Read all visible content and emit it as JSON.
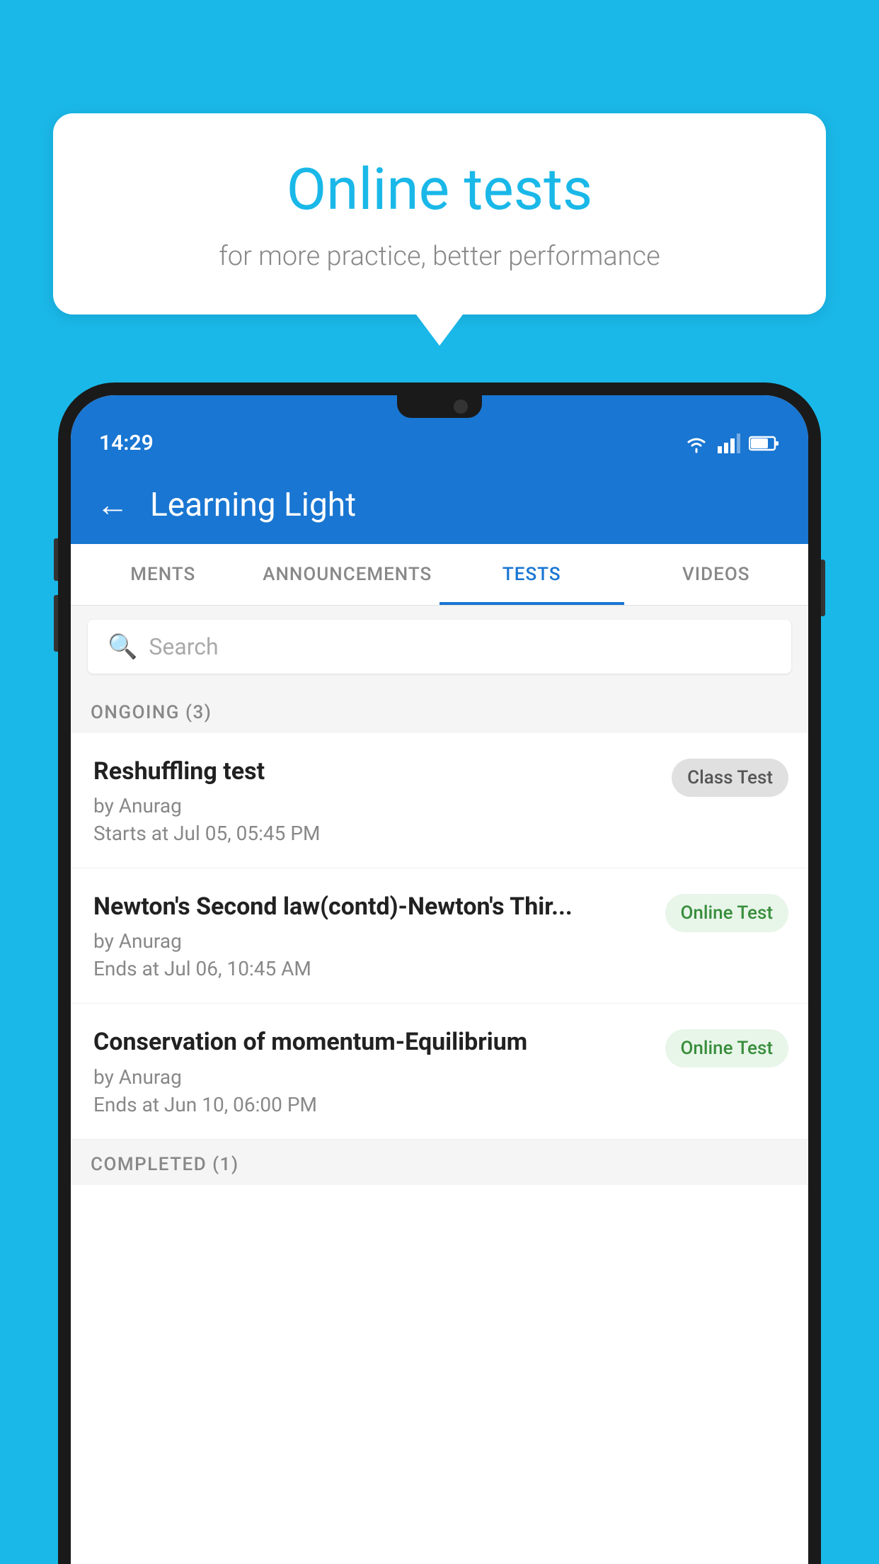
{
  "background_color": "#1ab8e8",
  "speech_bubble": {
    "title": "Online tests",
    "subtitle": "for more practice, better performance"
  },
  "phone": {
    "status_bar": {
      "time": "14:29"
    },
    "app_header": {
      "title": "Learning Light",
      "back_label": "←"
    },
    "tabs": [
      {
        "label": "MENTS",
        "active": false
      },
      {
        "label": "ANNOUNCEMENTS",
        "active": false
      },
      {
        "label": "TESTS",
        "active": true
      },
      {
        "label": "VIDEOS",
        "active": false
      }
    ],
    "search": {
      "placeholder": "Search"
    },
    "ongoing_section": {
      "label": "ONGOING (3)"
    },
    "tests": [
      {
        "name": "Reshuffling test",
        "author": "by Anurag",
        "time_label": "Starts at",
        "time": "Jul 05, 05:45 PM",
        "badge": "Class Test",
        "badge_type": "class"
      },
      {
        "name": "Newton's Second law(contd)-Newton's Thir...",
        "author": "by Anurag",
        "time_label": "Ends at",
        "time": "Jul 06, 10:45 AM",
        "badge": "Online Test",
        "badge_type": "online"
      },
      {
        "name": "Conservation of momentum-Equilibrium",
        "author": "by Anurag",
        "time_label": "Ends at",
        "time": "Jun 10, 06:00 PM",
        "badge": "Online Test",
        "badge_type": "online"
      }
    ],
    "completed_section": {
      "label": "COMPLETED (1)"
    }
  }
}
